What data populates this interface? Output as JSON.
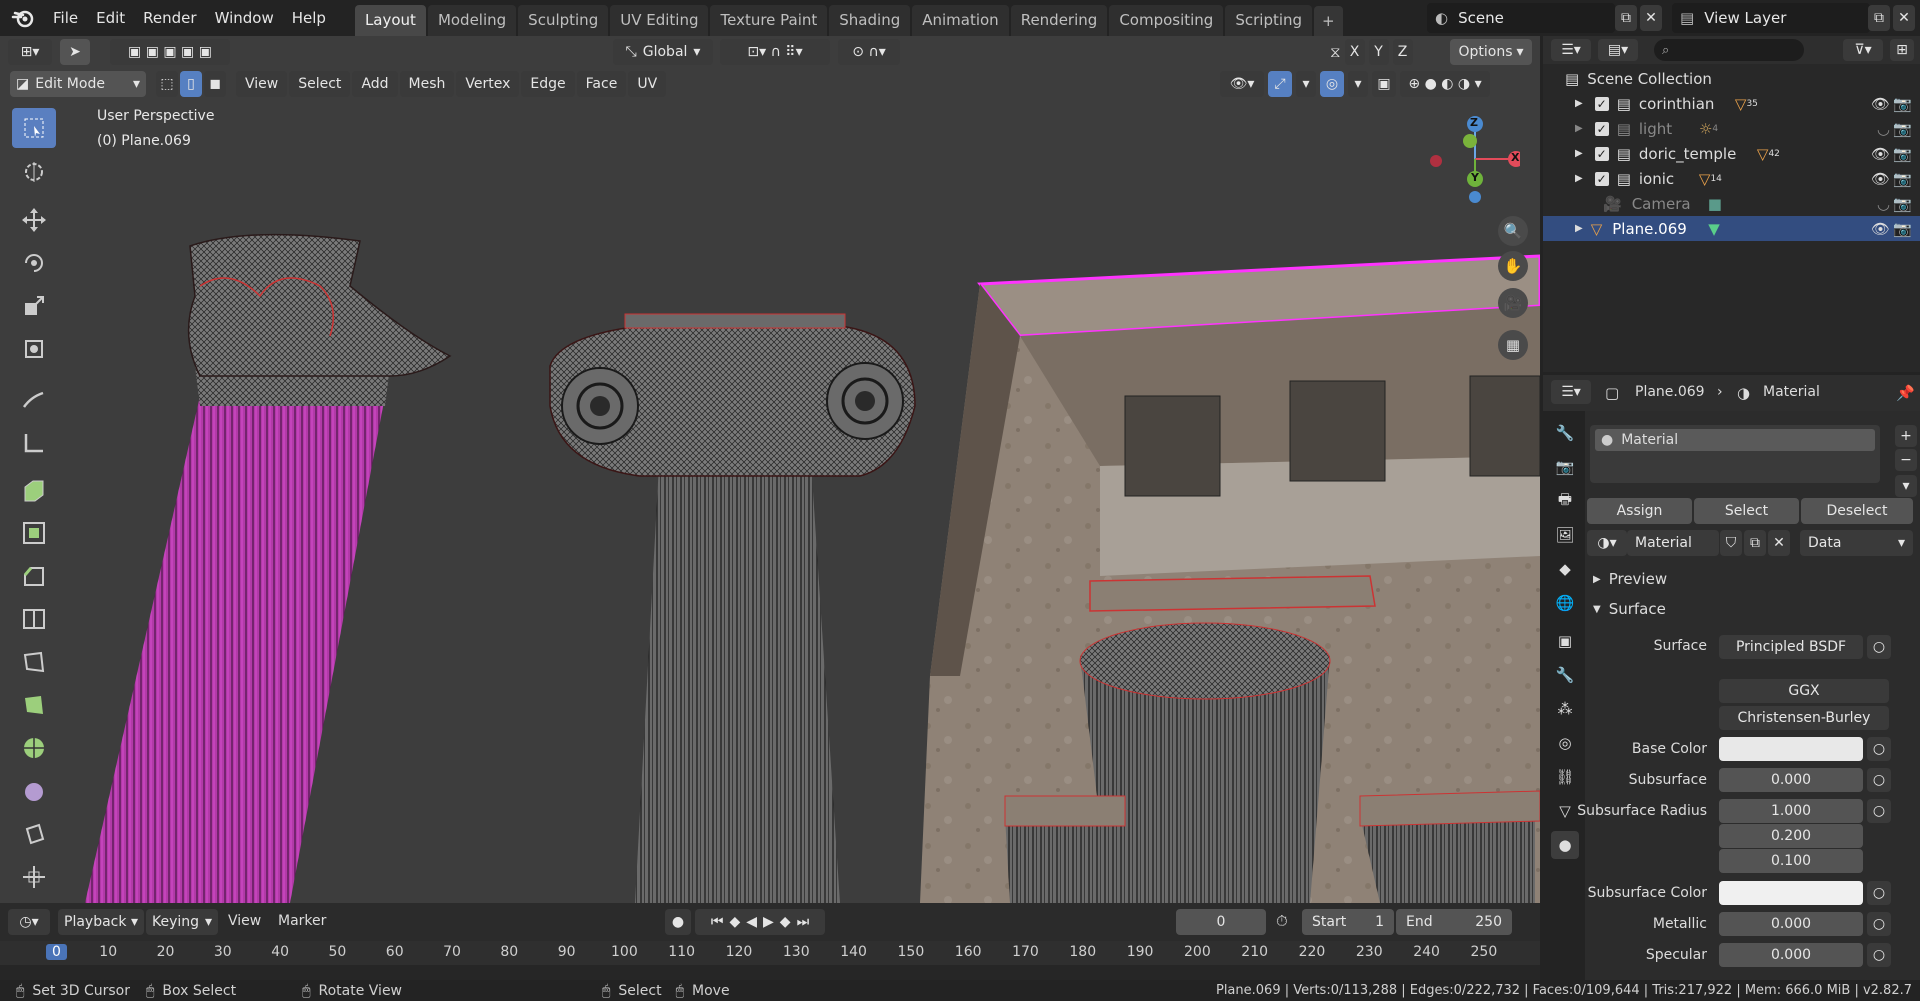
{
  "app": {
    "menus": [
      "File",
      "Edit",
      "Render",
      "Window",
      "Help"
    ],
    "workspace_tabs": [
      "Layout",
      "Modeling",
      "Sculpting",
      "UV Editing",
      "Texture Paint",
      "Shading",
      "Animation",
      "Rendering",
      "Compositing",
      "Scripting"
    ],
    "active_tab": "Layout",
    "add_tab": "+",
    "scene": "Scene",
    "view_layer": "View Layer"
  },
  "viewport": {
    "mode": "Edit Mode",
    "transform_orientation": "Global",
    "options_label": "Options",
    "axes": [
      "X",
      "Y",
      "Z"
    ],
    "header_menus": [
      "View",
      "Select",
      "Add",
      "Mesh",
      "Vertex",
      "Edge",
      "Face",
      "UV"
    ],
    "overlay_text": "User Perspective",
    "object_text": "(0) Plane.069",
    "gizmo_labels": {
      "z": "Z",
      "x": "X",
      "y": "Y"
    }
  },
  "toolbar": [
    "select-box",
    "cursor",
    "move",
    "rotate",
    "scale",
    "transform",
    "annotate",
    "measure",
    "extrude",
    "inset",
    "bevel",
    "loop-cut",
    "knife",
    "poly-build",
    "spin",
    "smooth",
    "shrink-fatten",
    "shear"
  ],
  "outliner": {
    "title": "Scene Collection",
    "search_placeholder": "",
    "items": [
      {
        "name": "corinthian",
        "badge": "35",
        "dim": false
      },
      {
        "name": "light",
        "badge": "4",
        "dim": true
      },
      {
        "name": "doric_temple",
        "badge": "42",
        "dim": false
      },
      {
        "name": "ionic",
        "badge": "14",
        "dim": false
      },
      {
        "name": "Camera",
        "badge": "",
        "dim": true
      },
      {
        "name": "Plane.069",
        "badge": "",
        "dim": false,
        "selected": true
      }
    ]
  },
  "properties": {
    "breadcrumb_object": "Plane.069",
    "breadcrumb_sep": "›",
    "breadcrumb_tab": "Material",
    "slot_name": "Material",
    "assign": "Assign",
    "select": "Select",
    "deselect": "Deselect",
    "material_name": "Material",
    "link": "Data",
    "preview": "Preview",
    "surface_panel": "Surface",
    "rows": [
      {
        "label": "Surface",
        "value": "Principled BSDF"
      },
      {
        "label": "",
        "value": "GGX"
      },
      {
        "label": "",
        "value": "Christensen-Burley"
      },
      {
        "label": "Base Color",
        "value": ""
      },
      {
        "label": "Subsurface",
        "value": "0.000"
      },
      {
        "label": "Subsurface Radius",
        "value": "1.000"
      },
      {
        "label": "",
        "value": "0.200"
      },
      {
        "label": "",
        "value": "0.100"
      },
      {
        "label": "Subsurface Color",
        "value": ""
      },
      {
        "label": "Metallic",
        "value": "0.000"
      },
      {
        "label": "Specular",
        "value": "0.000"
      }
    ]
  },
  "timeline": {
    "menus": [
      "Playback",
      "Keying",
      "View",
      "Marker"
    ],
    "current_frame": "0",
    "start_label": "Start",
    "start": "1",
    "end_label": "End",
    "end": "250",
    "ticks": [
      "0",
      "10",
      "20",
      "30",
      "40",
      "50",
      "60",
      "70",
      "80",
      "90",
      "100",
      "110",
      "120",
      "130",
      "140",
      "150",
      "160",
      "170",
      "180",
      "190",
      "200",
      "210",
      "220",
      "230",
      "240",
      "250"
    ]
  },
  "status": {
    "left": [
      "Set 3D Cursor",
      "Box Select",
      "Rotate View",
      "Select",
      "Move"
    ],
    "right": "Plane.069 | Verts:0/113,288 | Edges:0/222,732 | Faces:0/109,644 | Tris:217,922 | Mem: 666.0 MiB | v2.82.7"
  },
  "colors": {
    "accent": "#5680c2",
    "selected_row": "#334d80",
    "edge_sel": "#ff33ff",
    "wire": "#1a1a1a"
  }
}
